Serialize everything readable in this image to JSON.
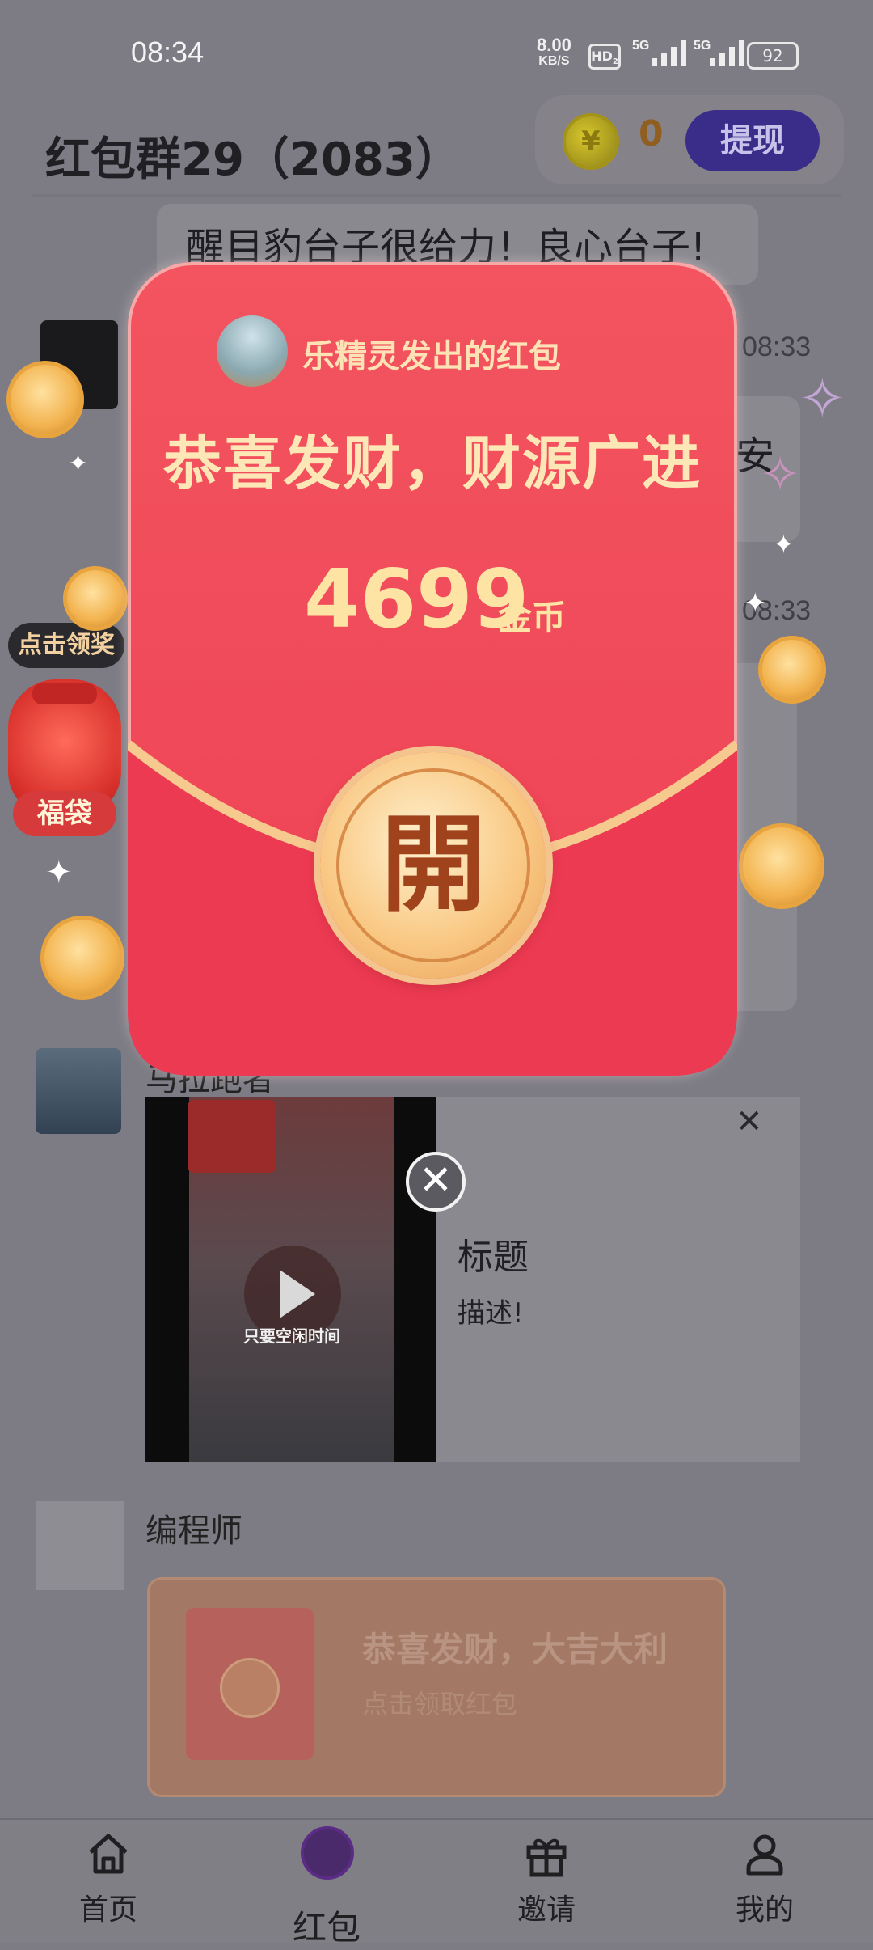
{
  "status_bar": {
    "time": "08:34",
    "net_speed_value": "8.00",
    "net_speed_unit": "KB/S",
    "hd_badge": "HD",
    "hd_sub": "2",
    "signal_1_label": "5G",
    "signal_2_label": "5G",
    "battery": "92"
  },
  "header": {
    "title": "红包群29（2083）",
    "coin_symbol": "¥",
    "coin_count": "0",
    "withdraw_label": "提现"
  },
  "chat": {
    "top_message": "醒目豹台子很给力！良心台子!",
    "timestamp_1": "08:33",
    "timestamp_2": "08:33",
    "partial_message_tail": "安",
    "partial_message_tail_2": "!"
  },
  "lucky_bag": {
    "tip": "点击领奖",
    "label": "福袋"
  },
  "red_packet_modal": {
    "sender_text": "乐精灵发出的红包",
    "greeting": "恭喜发财，财源广进",
    "amount": "4699",
    "amount_unit": "金币",
    "open_label": "開"
  },
  "ad": {
    "poster_name": "马拉跑者",
    "video_caption": "只要空闲时间",
    "close_glyph": "✕",
    "close_x_glyph": "✕",
    "title": "标题",
    "description": "描述!"
  },
  "message_2": {
    "sender": "编程师",
    "packet_title": "恭喜发财，大吉大利",
    "packet_subtitle": "点击领取红包"
  },
  "bottom_nav": {
    "items": [
      {
        "label": "首页",
        "icon": "home-icon"
      },
      {
        "label": "红包",
        "icon": "red-packet-icon"
      },
      {
        "label": "邀请",
        "icon": "gift-icon"
      },
      {
        "label": "我的",
        "icon": "person-icon"
      }
    ]
  },
  "colors": {
    "packet_red": "#f04a5a",
    "gold_text": "#fde3a4",
    "withdraw_purple": "#3a2d8a",
    "overlay_gray": "#7d7c84"
  }
}
